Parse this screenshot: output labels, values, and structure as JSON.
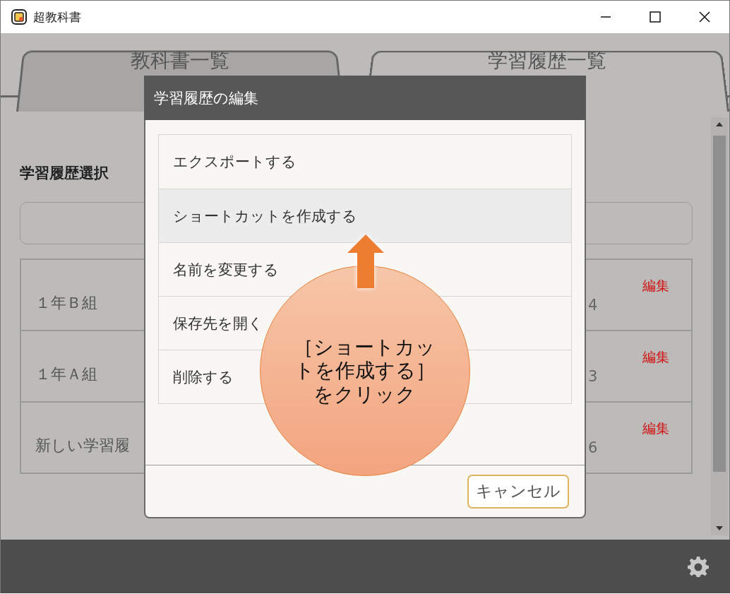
{
  "window": {
    "title": "超教科書"
  },
  "tabs": [
    {
      "label": "教科書一覧",
      "selected": false
    },
    {
      "label": "学習履歴一覧",
      "selected": true
    }
  ],
  "section_title": "学習履歴選択",
  "history_rows": [
    {
      "name": "１年Ｂ組",
      "column_2": "4",
      "edit": "編集"
    },
    {
      "name": "１年Ａ組",
      "column_2": "3",
      "edit": "編集"
    },
    {
      "name": "新しい学習履",
      "column_2": "6",
      "edit": "編集"
    }
  ],
  "dialog": {
    "title": "学習履歴の編集",
    "items": [
      {
        "label": "エクスポートする",
        "selected": false
      },
      {
        "label": "ショートカットを作成する",
        "selected": true
      },
      {
        "label": "名前を変更する",
        "selected": false
      },
      {
        "label": "保存先を開く",
        "selected": false
      },
      {
        "label": "削除する",
        "selected": false
      }
    ],
    "cancel": "キャンセル"
  },
  "callout": {
    "text": "［ショートカットを作成する］をクリック"
  }
}
